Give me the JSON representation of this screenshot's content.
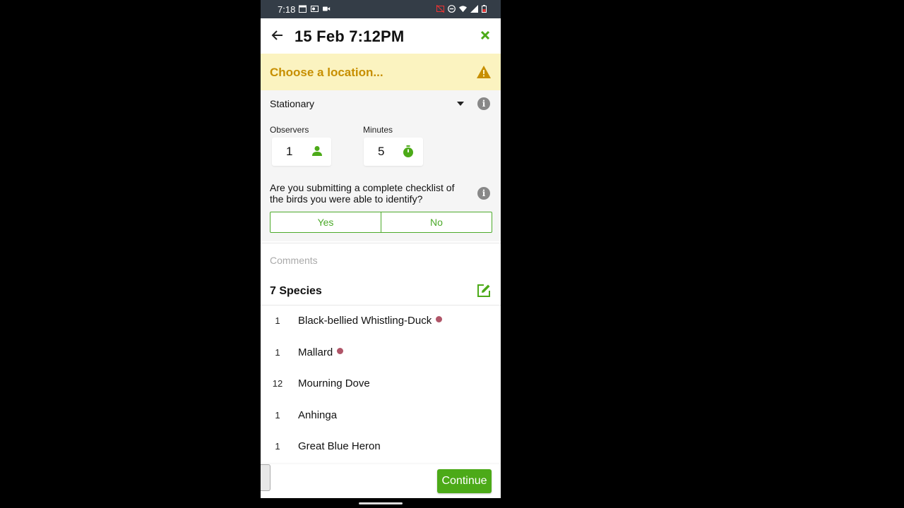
{
  "status_bar": {
    "time": "7:18"
  },
  "app_bar": {
    "title": "15 Feb 7:12PM"
  },
  "location_banner": {
    "text": "Choose a location..."
  },
  "protocol": {
    "selected": "Stationary"
  },
  "observers": {
    "label": "Observers",
    "value": "1"
  },
  "minutes": {
    "label": "Minutes",
    "value": "5"
  },
  "complete_question": {
    "text": "Are you submitting a complete checklist of the birds you were able to identify?",
    "yes": "Yes",
    "no": "No"
  },
  "comments": {
    "placeholder": "Comments"
  },
  "species": {
    "title": "7 Species",
    "items": [
      {
        "count": "1",
        "name": "Black-bellied Whistling-Duck",
        "flagged": true
      },
      {
        "count": "1",
        "name": "Mallard",
        "flagged": true
      },
      {
        "count": "12",
        "name": "Mourning Dove",
        "flagged": false
      },
      {
        "count": "1",
        "name": "Anhinga",
        "flagged": false
      },
      {
        "count": "1",
        "name": "Great Blue Heron",
        "flagged": false
      }
    ]
  },
  "actions": {
    "continue_label": "Continue"
  },
  "colors": {
    "accent": "#4caa18",
    "warning": "#c78f00",
    "banner_bg": "#fbf3c0",
    "flag_dot": "#b05568"
  }
}
